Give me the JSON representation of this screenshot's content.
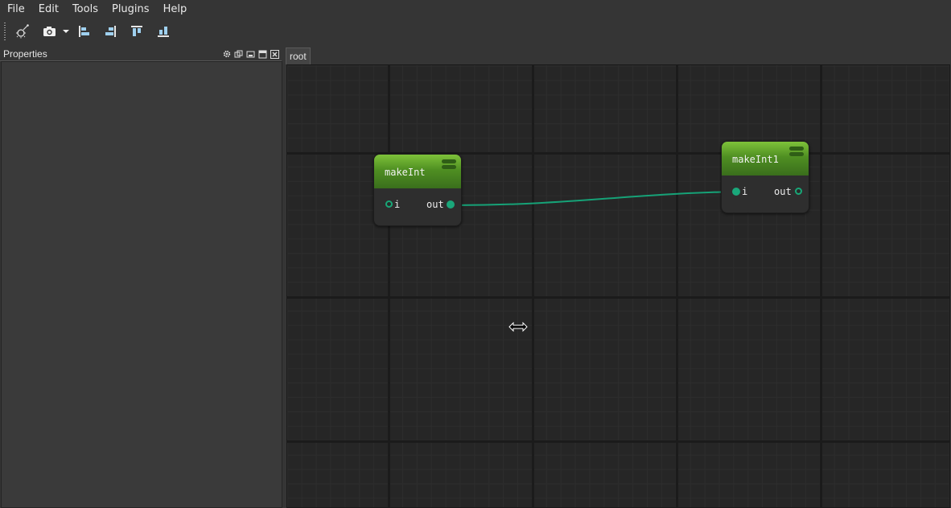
{
  "menu": [
    "File",
    "Edit",
    "Tools",
    "Plugins",
    "Help"
  ],
  "properties_panel": {
    "title": "Properties"
  },
  "graph": {
    "tab": "root",
    "nodes": [
      {
        "title": "makeInt",
        "input_label": "i",
        "output_label": "out"
      },
      {
        "title": "makeInt1",
        "input_label": "i",
        "output_label": "out"
      }
    ],
    "connection": {
      "from": "makeInt.out",
      "to": "makeInt1.i",
      "color": "#16a277"
    }
  },
  "colors": {
    "background": "#353535",
    "canvas": "#262626",
    "node_header": "#5fa22c",
    "port": "#1aa77a"
  }
}
